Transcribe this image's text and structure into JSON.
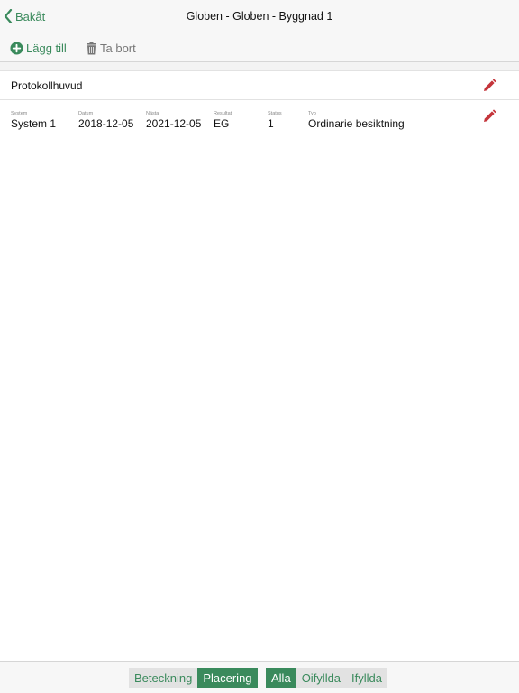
{
  "nav": {
    "back_label": "Bakåt",
    "title": "Globen - Globen - Byggnad 1"
  },
  "toolbar": {
    "add_label": "Lägg till",
    "delete_label": "Ta bort"
  },
  "protocol_header": {
    "label": "Protokollhuvud"
  },
  "record": {
    "system": {
      "caption": "System",
      "value": "System 1"
    },
    "datum": {
      "caption": "Datum",
      "value": "2018-12-05"
    },
    "nasta": {
      "caption": "Nästa",
      "value": "2021-12-05"
    },
    "resultat": {
      "caption": "Resultat",
      "value": "EG"
    },
    "status": {
      "caption": "Status",
      "value": "1"
    },
    "typ": {
      "caption": "Typ",
      "value": "Ordinarie besiktning"
    }
  },
  "footer": {
    "group1": [
      {
        "label": "Beteckning",
        "active": false
      },
      {
        "label": "Placering",
        "active": true
      }
    ],
    "group2": [
      {
        "label": "Alla",
        "active": true
      },
      {
        "label": "Oifyllda",
        "active": false
      },
      {
        "label": "Ifyllda",
        "active": false
      }
    ]
  },
  "colors": {
    "accent": "#3a8a5c",
    "edit_icon": "#c4343a",
    "disabled": "#777777"
  },
  "icons": {
    "back": "chevron-left-icon",
    "add": "plus-circle-icon",
    "delete": "trash-icon",
    "edit": "pencil-icon"
  }
}
